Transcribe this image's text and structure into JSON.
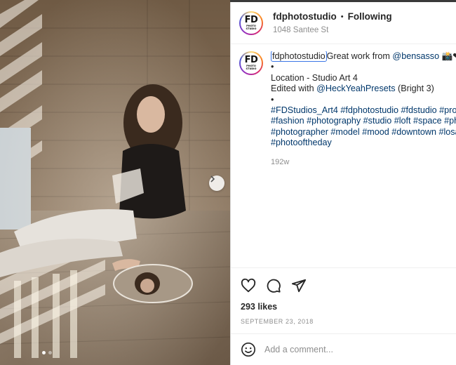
{
  "post": {
    "username": "fdphotostudio",
    "follow_status": "Following",
    "location": "1048 Santee St",
    "avatar_text": "FD",
    "avatar_subtext": "PHOTO STUDIO"
  },
  "caption": {
    "username": "fdphotostudio",
    "line1_text": "Great work from ",
    "line1_mention": "@bensasso",
    "line1_emoji": " 📸❤",
    "bullet1": "•",
    "line_location": "Location - Studio Art 4",
    "line_edited_prefix": "Edited with ",
    "line_edited_mention": "@HeckYeahPresets",
    "line_edited_suffix": " (Bright 3)",
    "bullet2": "•",
    "hashtags_line1": "#FDStudios_Art4 #fdphotostudio #fdstudio #pro",
    "hashtags_line2": "#fashion #photography #studio #loft #space #ph",
    "hashtags_line3": "#photographer #model #mood #downtown #losa",
    "hashtags_line4": "#photooftheday",
    "time_ago": "192w"
  },
  "engagement": {
    "likes": "293 likes",
    "date": "SEPTEMBER 23, 2018"
  },
  "comment": {
    "placeholder": "Add a comment..."
  },
  "carousel": {
    "slide_count": 2,
    "active_slide": 1
  },
  "icons": {
    "like": "heart-icon",
    "comment": "comment-icon",
    "share": "paper-plane-icon",
    "emoji": "smiley-icon",
    "next": "chevron-right-icon"
  }
}
